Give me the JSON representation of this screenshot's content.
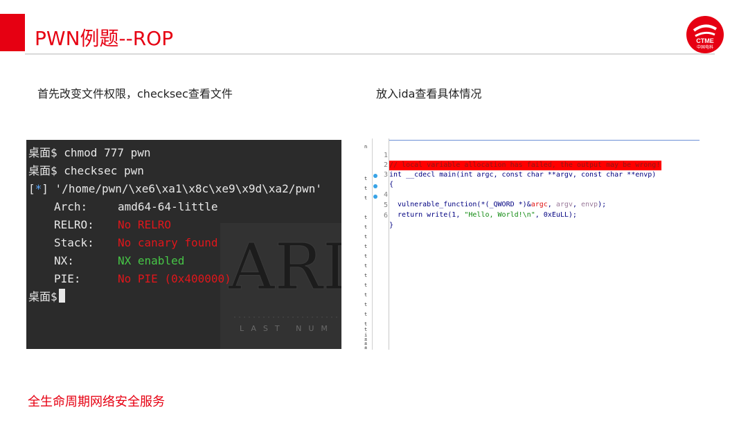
{
  "slide": {
    "title": "PWN例题--ROP",
    "footer": "全生命周期网络安全服务",
    "accent_color": "#e60012"
  },
  "logo": {
    "text": "CTME",
    "subtext": "中国电科"
  },
  "captions": {
    "left": "首先改变文件权限，checksec查看文件",
    "right": "放入ida查看具体情况"
  },
  "terminal": {
    "prompt": "桌面$",
    "cmd1": " chmod 777 pwn",
    "cmd2": " checksec pwn",
    "path_prefix": "[",
    "path_star": "*",
    "path_rest": "] '/home/pwn/\\xe6\\xa1\\x8c\\xe9\\x9d\\xa2/pwn'",
    "rows": [
      {
        "label": "Arch:",
        "value": "amd64-64-little"
      },
      {
        "label": "RELRO:",
        "value": "No RELRO"
      },
      {
        "label": "Stack:",
        "value": "No canary found"
      },
      {
        "label": "NX:",
        "value": "NX enabled"
      },
      {
        "label": "PIE:",
        "value": "No PIE (0x400000)"
      }
    ],
    "bg_text": "ARIA",
    "bg_sub": "LAST NUM"
  },
  "ida": {
    "line_numbers": [
      "1",
      "2",
      "3",
      "4",
      "5",
      "6"
    ],
    "l1": "// local variable allocation has failed, the output may be wrong!",
    "l2": "int __cdecl main(int argc, const char **argv, const char **envp)",
    "l3": "{",
    "l4a": "  vulnerable_function(*(_QWORD *)&",
    "l4b": "argc",
    "l4c": ", ",
    "l4d": "argv",
    "l4e": ", ",
    "l4f": "envp",
    "l4g": ");",
    "l5a": "  return write(1, ",
    "l5b": "\"Hello, World!\\n\"",
    "l5c": ", 0xEuLL);",
    "l6": "}",
    "gutter_top": "n",
    "gutter_chars": [
      "t",
      "t",
      "t",
      "t",
      "t",
      "t",
      "t",
      "t",
      "t",
      "t",
      "t",
      "t",
      "t",
      "t",
      "t",
      "t",
      "i",
      "±",
      "±",
      "±"
    ]
  }
}
